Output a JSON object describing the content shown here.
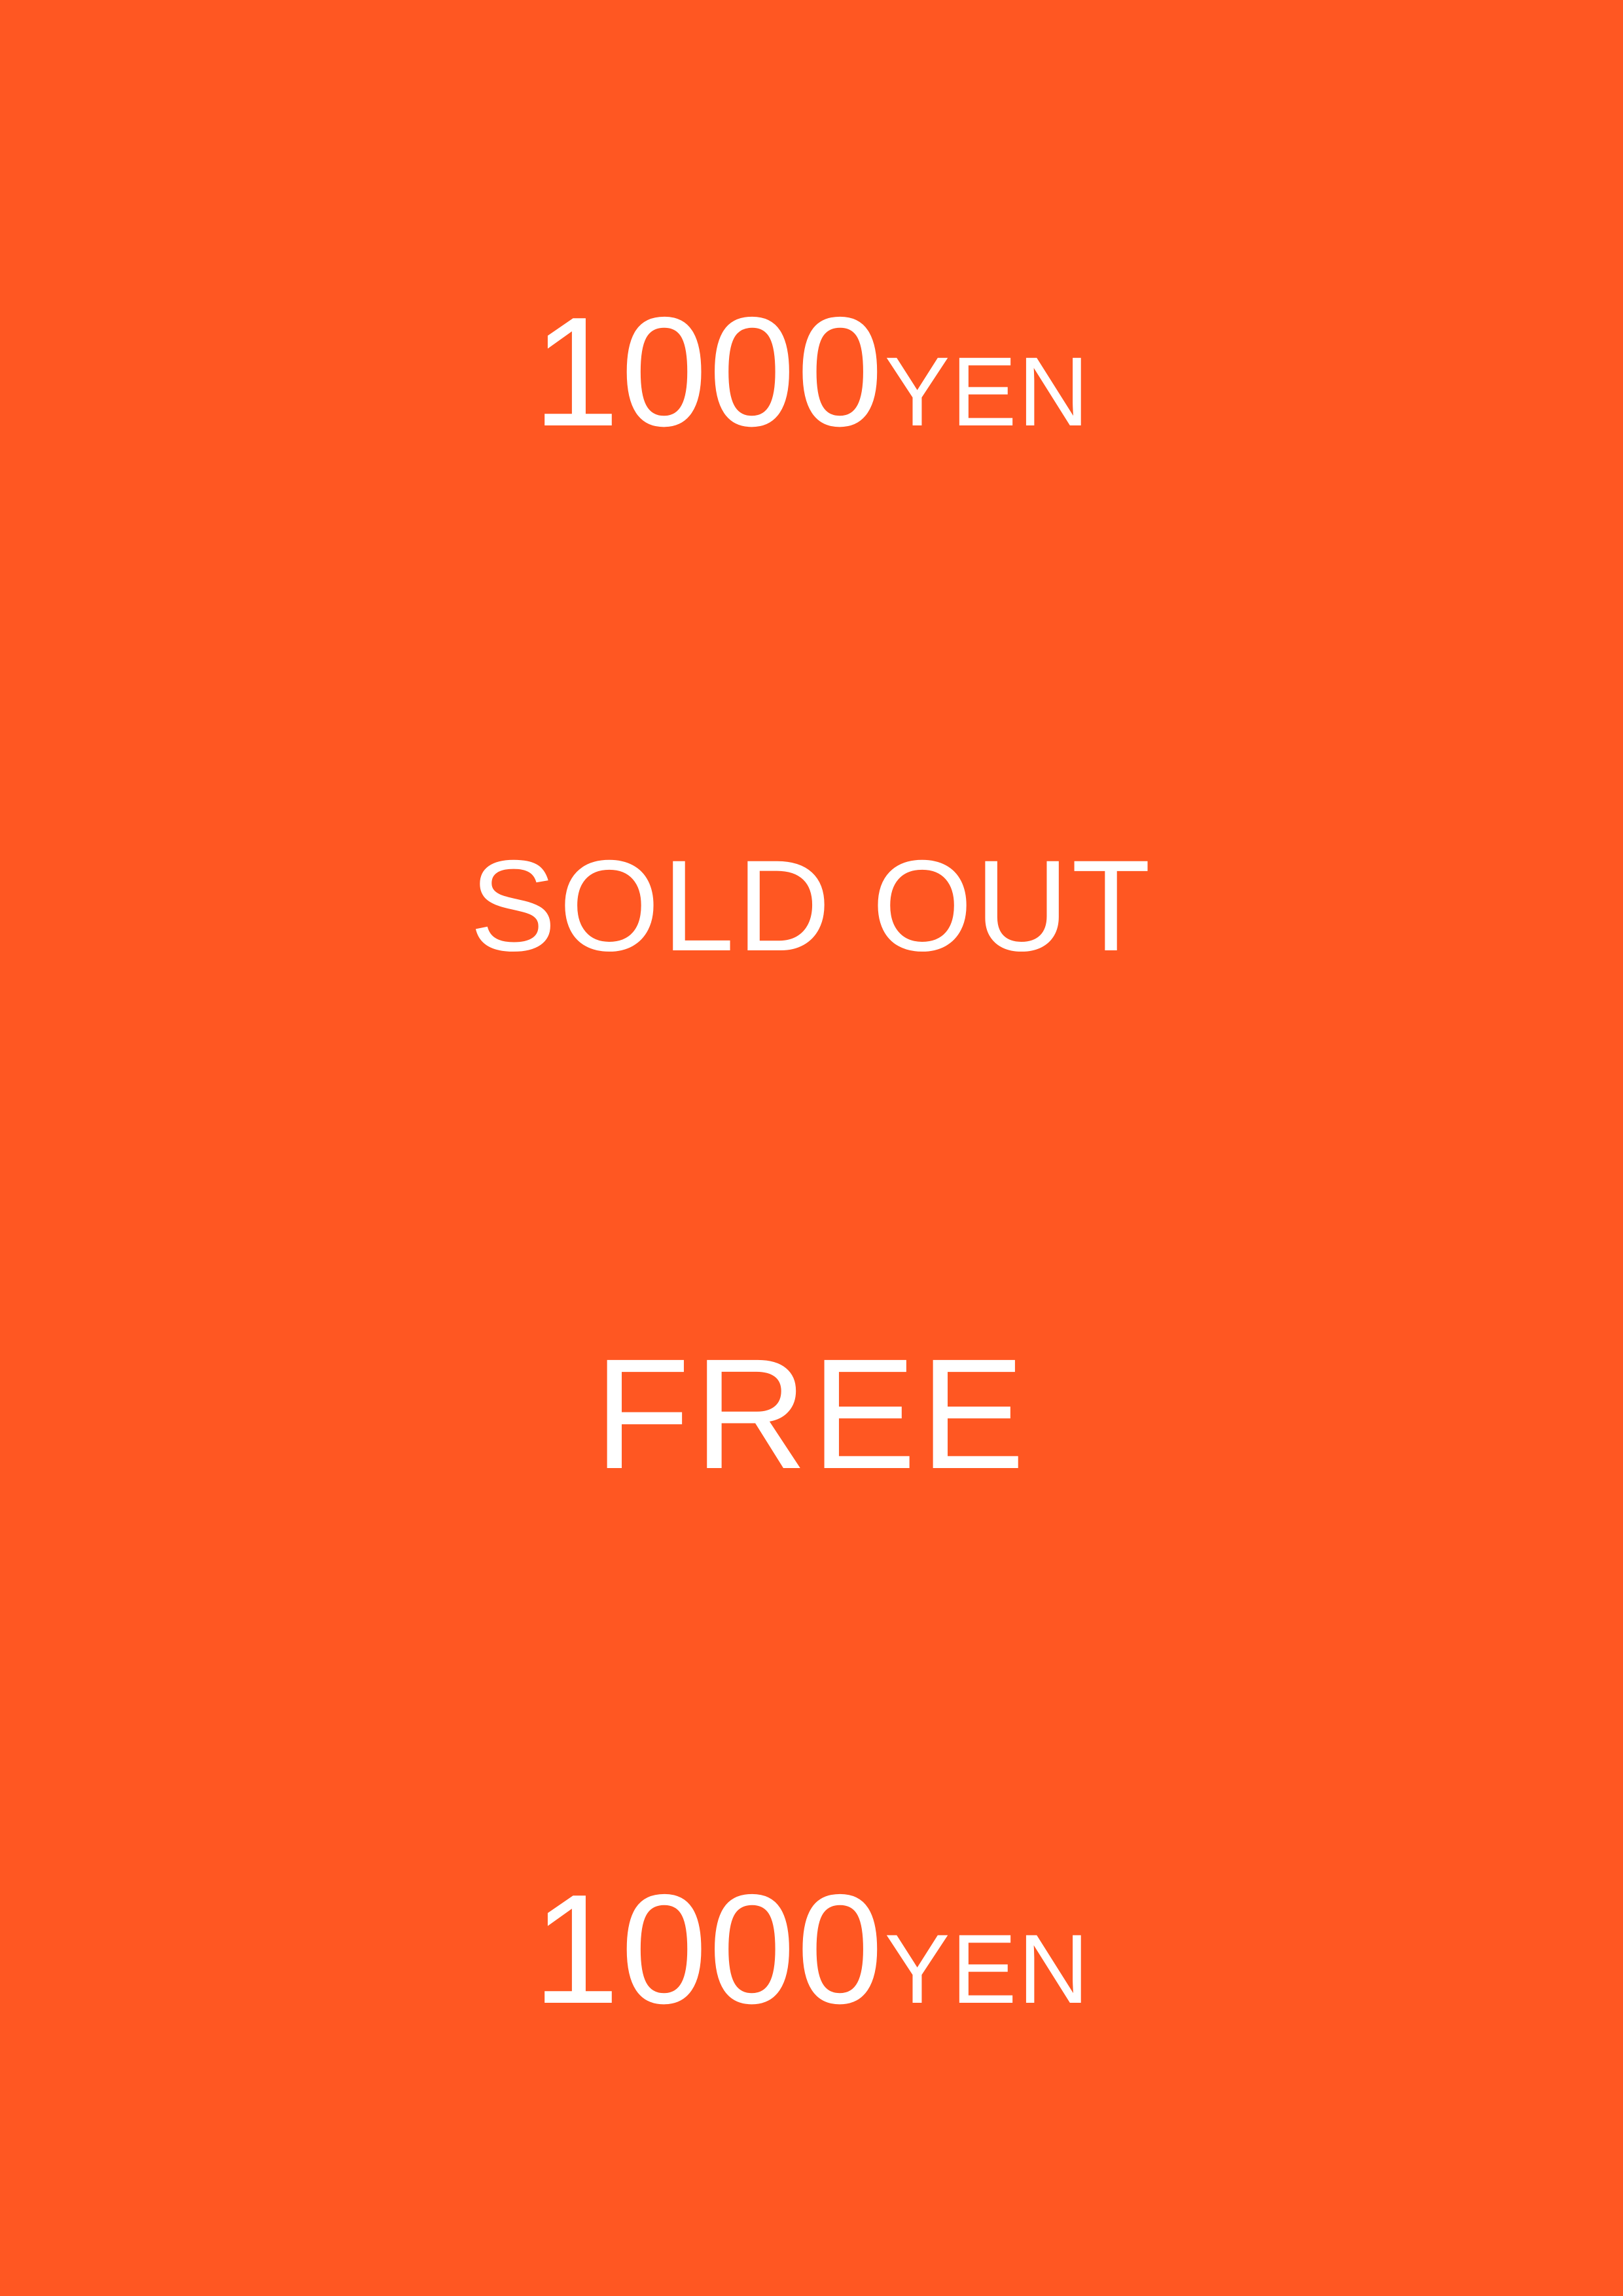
{
  "background_color": "#ff5722",
  "text_color": "#ffffff",
  "labels": {
    "price_top": {
      "amount": "1000",
      "unit": "YEN"
    },
    "sold_out": "SOLD OUT",
    "free": "FREE",
    "price_bottom": {
      "amount": "1000",
      "unit": "YEN"
    }
  }
}
